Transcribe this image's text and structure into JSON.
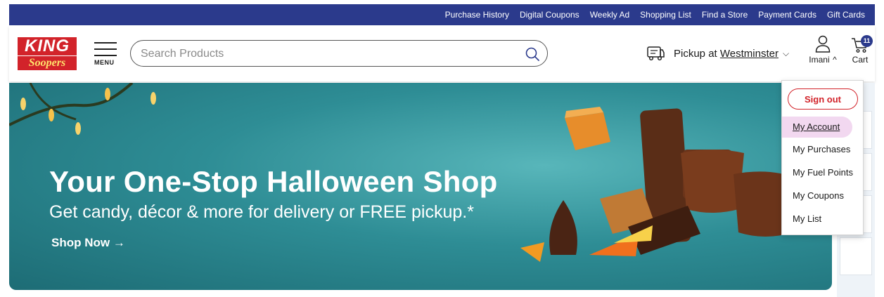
{
  "utility_nav": [
    "Purchase History",
    "Digital Coupons",
    "Weekly Ad",
    "Shopping List",
    "Find a Store",
    "Payment Cards",
    "Gift Cards"
  ],
  "logo": {
    "line1": "KING",
    "line2": "Soopers"
  },
  "menu": {
    "label": "MENU"
  },
  "search": {
    "placeholder": "Search Products"
  },
  "pickup": {
    "prefix": "Pickup at ",
    "store": "Westminster"
  },
  "account": {
    "name": "Imani"
  },
  "cart": {
    "label": "Cart",
    "count": "11"
  },
  "hero": {
    "headline": "Your One-Stop Halloween Shop",
    "subline": "Get candy, décor & more for delivery or FREE pickup.*",
    "cta": "Shop Now →"
  },
  "account_menu": {
    "sign_out": "Sign out",
    "items": [
      "My Account",
      "My Purchases",
      "My Fuel Points",
      "My Coupons",
      "My List"
    ],
    "active_item": "My Account"
  },
  "colors": {
    "utility_bar": "#2b3a8c",
    "brand_red": "#d2232a",
    "hero_teal": "#2e8d95",
    "active_menu_bg": "#f2d8f0"
  }
}
